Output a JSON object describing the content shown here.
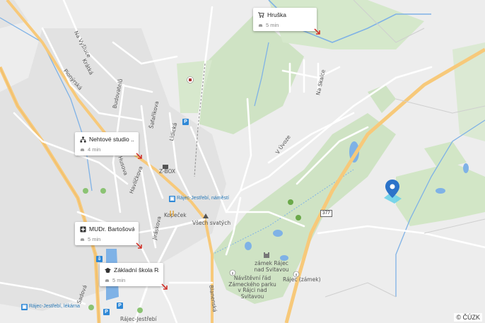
{
  "map": {
    "copyright": "© ČÚZK",
    "road_number": "377",
    "street_labels": [
      "Na Vyšluce",
      "Krátká",
      "Pionýrská",
      "Budovatelů",
      "Šafaříkova",
      "Lidická",
      "Husova",
      "Havlíčkova",
      "Jiráskova",
      "Na Skalce",
      "V Úvoze",
      "Blanenská",
      "Kopeček",
      "Všech svatých",
      "Sadová"
    ],
    "place_labels": {
      "zbox": "Z-BOX",
      "stop_namesti": "Rájec-Jestřebí, náměstí",
      "stop_lekarna": "Rájec-Jestřebí, lékárna",
      "zamek": "zámek Rájec nad Svitavou",
      "zamek_short": "Rájec (zámek)",
      "info_center": "Návštěvní řád Zámeckého parku v Rájci nad Svitavou",
      "blanensk_bottom": "Rájec-Jestřebí"
    }
  },
  "cards": [
    {
      "icon": "cart-icon",
      "title": "Hruška",
      "travel": "5 min"
    },
    {
      "icon": "network-icon",
      "title": "Nehtové studio ...",
      "travel": "4 min"
    },
    {
      "icon": "medical-icon",
      "title": "MUDr. Bartošová ...",
      "travel": "5 min"
    },
    {
      "icon": "school-icon",
      "title": "Základní škola Rá...",
      "travel": "5 min"
    }
  ],
  "colors": {
    "background": "#ededed",
    "park": "#cfe3c4",
    "road_major": "#f7c97a",
    "water": "#7fb2e6",
    "pin": "#2b73c9",
    "pin_halo": "#6cd2e8",
    "transit_blue": "#2f88d6"
  },
  "marker": {
    "icon": "location-pin-icon"
  }
}
